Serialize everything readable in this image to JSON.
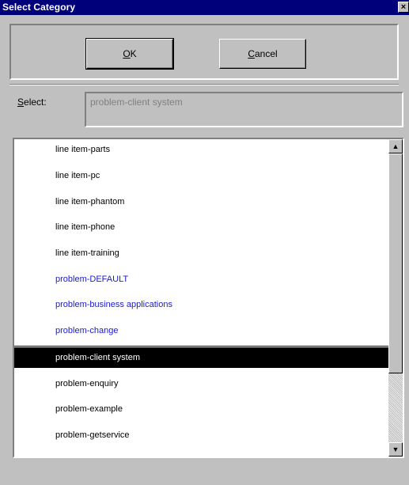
{
  "window": {
    "title": "Select Category",
    "close_glyph": "×"
  },
  "buttons": {
    "ok": {
      "mnemonic": "O",
      "rest": "K"
    },
    "cancel": {
      "mnemonic": "C",
      "rest": "ancel"
    }
  },
  "select": {
    "label_mnemonic": "S",
    "label_rest": "elect:",
    "value": "problem-client system"
  },
  "list": {
    "items": [
      {
        "label": "line item-parts",
        "style": "normal"
      },
      {
        "label": "line item-pc",
        "style": "normal"
      },
      {
        "label": "line item-phantom",
        "style": "normal"
      },
      {
        "label": "line item-phone",
        "style": "normal"
      },
      {
        "label": "line item-training",
        "style": "normal"
      },
      {
        "label": "problem-DEFAULT",
        "style": "blue"
      },
      {
        "label": "problem-business applications",
        "style": "blue"
      },
      {
        "label": "problem-change",
        "style": "blue"
      },
      {
        "label": "problem-client system",
        "style": "selected"
      },
      {
        "label": "problem-enquiry",
        "style": "normal"
      },
      {
        "label": "problem-example",
        "style": "normal"
      },
      {
        "label": "problem-getservice",
        "style": "normal"
      }
    ]
  },
  "scrollbar": {
    "up_icon": "▲",
    "down_icon": "▼"
  },
  "colors": {
    "title_bar": "#00007b",
    "category_link": "#1a1acd",
    "selection": "#000000",
    "face": "#c0c0c0"
  }
}
